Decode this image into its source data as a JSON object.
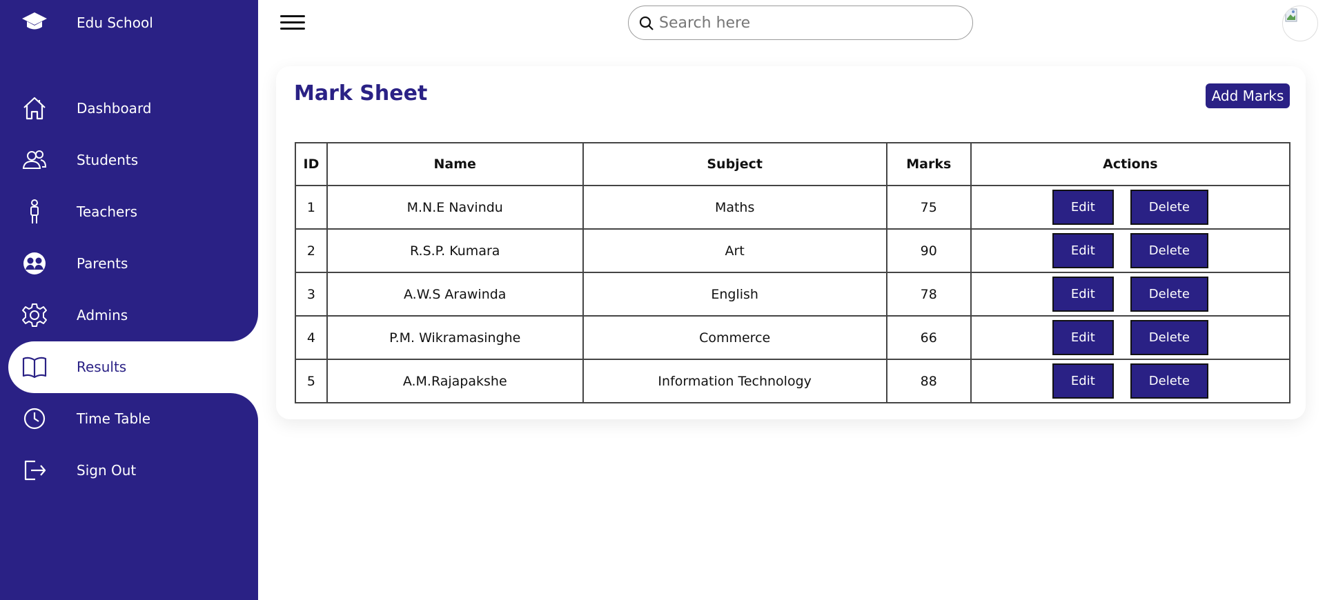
{
  "sidebar": {
    "brand": {
      "label": "Edu School",
      "icon": "graduation-cap-icon"
    },
    "items": [
      {
        "label": "Dashboard",
        "icon": "home-icon",
        "active": false
      },
      {
        "label": "Students",
        "icon": "people-icon",
        "active": false
      },
      {
        "label": "Teachers",
        "icon": "person-icon",
        "active": false
      },
      {
        "label": "Parents",
        "icon": "people-circle-icon",
        "active": false
      },
      {
        "label": "Admins",
        "icon": "gear-icon",
        "active": false
      },
      {
        "label": "Results",
        "icon": "book-icon",
        "active": true
      },
      {
        "label": "Time Table",
        "icon": "clock-icon",
        "active": false
      },
      {
        "label": "Sign Out",
        "icon": "sign-out-icon",
        "active": false
      }
    ]
  },
  "topbar": {
    "search_placeholder": "Search here",
    "search_value": ""
  },
  "main": {
    "title": "Mark Sheet",
    "add_button": "Add Marks",
    "table": {
      "headers": [
        "ID",
        "Name",
        "Subject",
        "Marks",
        "Actions"
      ],
      "rows": [
        {
          "id": "1",
          "name": "M.N.E Navindu",
          "subject": "Maths",
          "marks": "75"
        },
        {
          "id": "2",
          "name": "R.S.P. Kumara",
          "subject": "Art",
          "marks": "90"
        },
        {
          "id": "3",
          "name": "A.W.S Arawinda",
          "subject": "English",
          "marks": "78"
        },
        {
          "id": "4",
          "name": "P.M. Wikramasinghe",
          "subject": "Commerce",
          "marks": "66"
        },
        {
          "id": "5",
          "name": "A.M.Rajapakshe",
          "subject": "Information Technology",
          "marks": "88"
        }
      ],
      "edit_label": "Edit",
      "delete_label": "Delete"
    }
  },
  "colors": {
    "primary": "#2a2185",
    "white": "#ffffff"
  }
}
